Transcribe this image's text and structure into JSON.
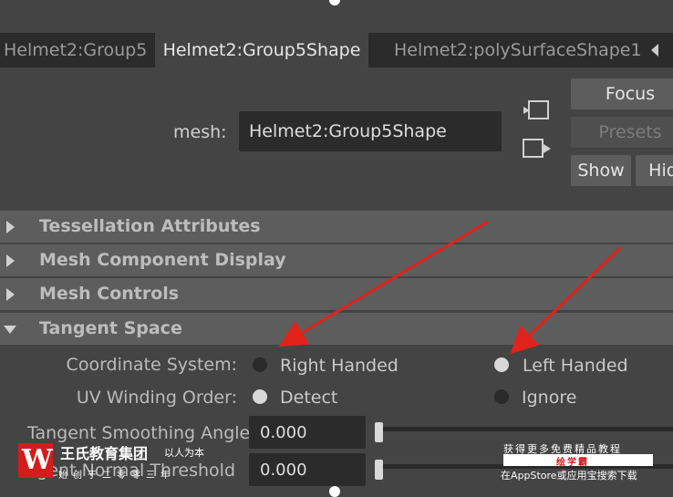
{
  "tabs": [
    {
      "label": "Helmet2:Group5"
    },
    {
      "label": "Helmet2:Group5Shape"
    },
    {
      "label": "Helmet2:polySurfaceShape1"
    }
  ],
  "mesh": {
    "label": "mesh:",
    "value": "Helmet2:Group5Shape"
  },
  "buttons": {
    "focus": "Focus",
    "presets": "Presets",
    "show": "Show",
    "hide": "Hid"
  },
  "icons": {
    "load": "load-attributes-icon",
    "copy": "copy-tab-icon"
  },
  "sections": [
    {
      "title": "Tessellation Attributes",
      "expanded": false
    },
    {
      "title": "Mesh Component Display",
      "expanded": false
    },
    {
      "title": "Mesh Controls",
      "expanded": false
    },
    {
      "title": "Tangent Space",
      "expanded": true
    }
  ],
  "tangent_space": {
    "coordinate_system": {
      "label": "Coordinate System:",
      "options": [
        "Right Handed",
        "Left Handed"
      ],
      "selected": "Left Handed"
    },
    "uv_winding_order": {
      "label": "UV Winding Order:",
      "options": [
        "Detect",
        "Ignore"
      ],
      "selected": "Detect"
    },
    "smoothing_angle": {
      "label": "Tangent Smoothing Angle",
      "value": "0.000"
    },
    "normal_threshold": {
      "label": "gent Normal Threshold",
      "value": "0.000"
    }
  },
  "colors": {
    "annotation_arrow": "#e0231b",
    "watermark_red": "#d41c1c"
  },
  "watermark": {
    "logo": "W",
    "name": "王氏教育集团",
    "slogan": "以人为本",
    "sub": "始创于二零零三年",
    "right_line1": "获得更多免费精品教程",
    "right_line2": "绘学霸",
    "right_line3": "在AppStore或应用宝搜索下载"
  }
}
